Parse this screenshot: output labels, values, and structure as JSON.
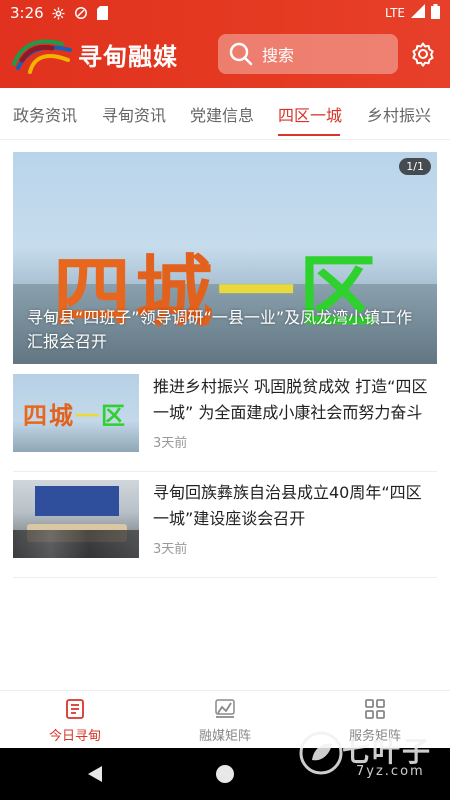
{
  "status_bar": {
    "time": "3:26",
    "network": "LTE"
  },
  "header": {
    "app_name": "寻甸融媒",
    "search_placeholder": "搜索"
  },
  "tabs": [
    {
      "label": "政务资讯",
      "active": false
    },
    {
      "label": "寻甸资讯",
      "active": false
    },
    {
      "label": "党建信息",
      "active": false
    },
    {
      "label": "四区一城",
      "active": true
    },
    {
      "label": "乡村振兴",
      "active": false
    }
  ],
  "banner": {
    "image_text": [
      "四",
      "城",
      "一",
      "区"
    ],
    "counter": "1/1",
    "caption": "寻甸县“四班子”领导调研“一县一业”及凤龙湾小镇工作汇报会召开"
  },
  "news": [
    {
      "title": "推进乡村振兴 巩固脱贫成效 打造“四区一城” 为全面建成小康社会而努力奋斗",
      "time": "3天前",
      "thumb_text": [
        "四",
        "城",
        "一",
        "区"
      ]
    },
    {
      "title": "寻甸回族彝族自治县成立40周年“四区一城”建设座谈会召开",
      "time": "3天前"
    }
  ],
  "bottom_nav": [
    {
      "label": "今日寻甸",
      "active": true,
      "icon": "news-icon"
    },
    {
      "label": "融媒矩阵",
      "active": false,
      "icon": "media-icon"
    },
    {
      "label": "服务矩阵",
      "active": false,
      "icon": "grid-icon"
    }
  ],
  "watermark": {
    "text": "七叶子",
    "domain": "7yz.com"
  },
  "colors": {
    "brand_red": "#e0321e",
    "active_tab": "#d9342a",
    "text_muted": "#999999"
  }
}
